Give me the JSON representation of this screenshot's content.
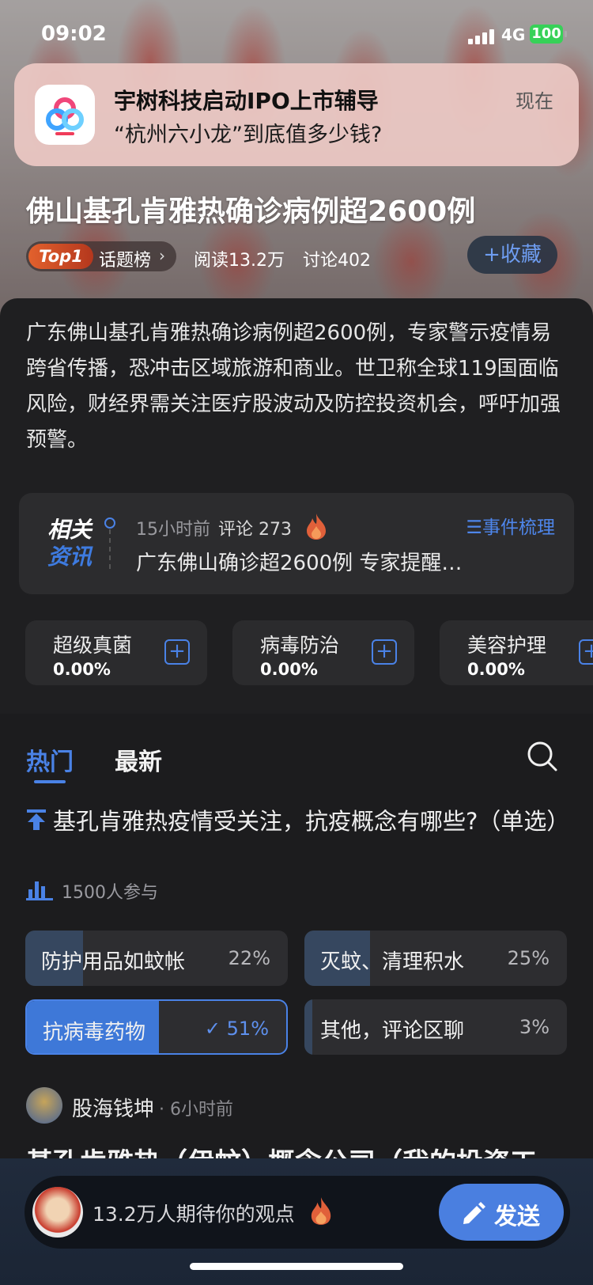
{
  "status_bar": {
    "time": "09:02",
    "network": "4G",
    "battery": "100"
  },
  "notification": {
    "title": "宇树科技启动IPO上市辅导",
    "body": "“杭州六小龙”到底值多少钱?",
    "time": "现在",
    "app_icon": "baidu-cloud-icon"
  },
  "topic": {
    "title": "佛山基孔肯雅热确诊病例超2600例",
    "rank_badge": "Top1",
    "rank_label": "话题榜",
    "reads": "阅读13.2万",
    "discussions": "讨论402",
    "favorite_label": "收藏"
  },
  "summary": "广东佛山基孔肯雅热确诊病例超2600例，专家警示疫情易跨省传播，恐冲击区域旅游和商业。世卫称全球119国面临风险，财经界需关注医疗股波动及防控投资机会，呼吁加强预警。",
  "related": {
    "label_line1": "相关",
    "label_line2": "资讯",
    "time": "15小时前",
    "comments": "评论 273",
    "timeline_link": "事件梳理",
    "headline": "广东佛山确诊超2600例 专家提醒…"
  },
  "concepts": [
    {
      "name": "超级真菌",
      "pct": "0.00%"
    },
    {
      "name": "病毒防治",
      "pct": "0.00%"
    },
    {
      "name": "美容护理",
      "pct": "0.00%"
    }
  ],
  "tabs": {
    "hot": "热门",
    "latest": "最新"
  },
  "poll": {
    "question": "基孔肯雅热疫情受关注，抗疫概念有哪些?（单选）",
    "participants": "1500人参与",
    "options": [
      {
        "label": "防护用品如蚊帐",
        "pct": "22%",
        "value": 22,
        "selected": false
      },
      {
        "label": "灭蚊、清理积水",
        "pct": "25%",
        "value": 25,
        "selected": false
      },
      {
        "label": "抗病毒药物",
        "pct": "51%",
        "value": 51,
        "selected": true
      },
      {
        "label": "其他，评论区聊",
        "pct": "3%",
        "value": 3,
        "selected": false
      }
    ]
  },
  "post": {
    "author": "股海钱坤",
    "time": "· 6小时前",
    "title": "基孔肯雅热（伊蚊）概念公司（我的投资工"
  },
  "composer": {
    "placeholder": "13.2万人期待你的观点",
    "send_label": "发送"
  },
  "colors": {
    "accent": "#4a82e6",
    "rank_badge": "#d54e25",
    "battery": "#37d158"
  }
}
